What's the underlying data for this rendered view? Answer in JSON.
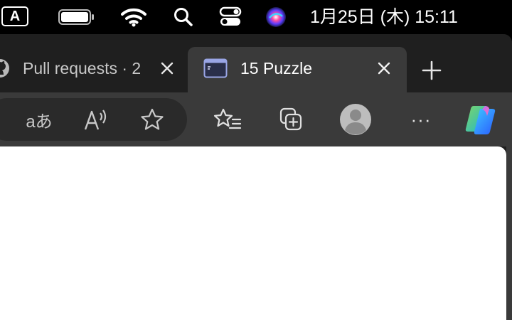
{
  "menubar": {
    "input_source": "A",
    "clock": "1月25日 (木)  15:11",
    "icons": [
      "keyboard-input-icon",
      "battery-icon",
      "wifi-icon",
      "spotlight-search-icon",
      "control-center-icon",
      "siri-icon"
    ]
  },
  "tabs": [
    {
      "title": "Pull requests · 2",
      "active": false,
      "favicon": "github-icon"
    },
    {
      "title": "15 Puzzle",
      "active": true,
      "favicon": "window-icon"
    }
  ],
  "toolbar": {
    "buttons": [
      "read-aloud-translate-icon",
      "read-aloud-icon",
      "favorite-star-icon",
      "favorites-list-icon",
      "collections-icon",
      "profile-avatar-icon",
      "more-menu-icon",
      "copilot-icon"
    ],
    "translate_glyph": "aあ",
    "more_glyph": "···"
  },
  "colors": {
    "background": "#000000",
    "tab_strip": "#1f1f1f",
    "active_tab": "#3a3a3a",
    "page": "#ffffff"
  }
}
